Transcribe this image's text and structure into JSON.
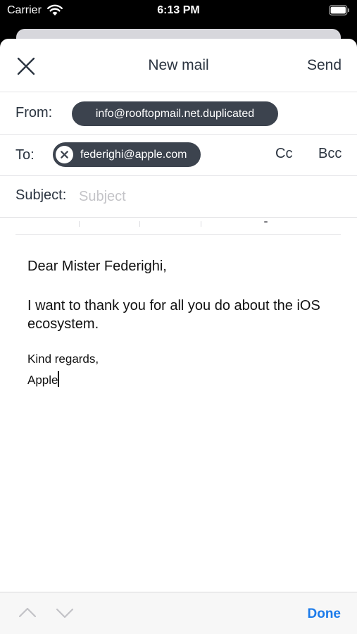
{
  "status_bar": {
    "carrier": "Carrier",
    "time": "6:13 PM"
  },
  "nav": {
    "title": "New mail",
    "send_label": "Send"
  },
  "from": {
    "label": "From:",
    "address": "info@rooftopmail.net.duplicated"
  },
  "to": {
    "label": "To:",
    "recipient": "federighi@apple.com",
    "cc_label": "Cc",
    "bcc_label": "Bcc"
  },
  "subject": {
    "label": "Subject:",
    "value": "",
    "placeholder": "Subject"
  },
  "body": {
    "greeting": "Dear Mister Federighi,",
    "paragraph": "I want to thank you for all you do about the iOS ecosystem.",
    "closing": "Kind regards,",
    "signature": "Apple"
  },
  "keyboard_toolbar": {
    "done_label": "Done"
  },
  "colors": {
    "accent": "#1c7bea",
    "chip": "#3c434e",
    "text": "#2b3440"
  },
  "icons": [
    "wifi-icon",
    "battery-icon",
    "close-icon",
    "remove-recipient-icon",
    "chevron-up-icon",
    "chevron-down-icon"
  ]
}
